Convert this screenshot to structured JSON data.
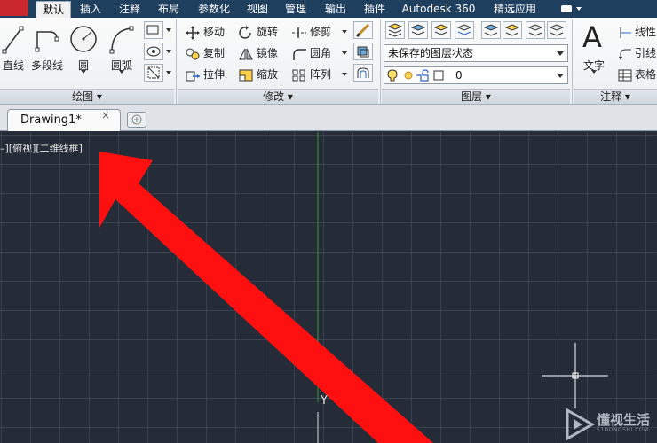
{
  "ribbon_tabs": [
    "默认",
    "插入",
    "注释",
    "布局",
    "参数化",
    "视图",
    "管理",
    "输出",
    "插件",
    "Autodesk 360",
    "精选应用"
  ],
  "active_tab_index": 0,
  "draw_panel": {
    "title": "绘图",
    "line_label": "直线",
    "polyline_label": "多段线",
    "circle_label": "圆",
    "arc_label": "圆弧"
  },
  "modify_panel": {
    "title": "修改",
    "move": "移动",
    "rotate": "旋转",
    "trim": "修剪",
    "copy": "复制",
    "mirror": "镜像",
    "fillet": "圆角",
    "stretch": "拉伸",
    "scale": "缩放",
    "array": "阵列"
  },
  "layers_panel": {
    "title": "图层",
    "layer_state": "未保存的图层状态",
    "current_layer": "0"
  },
  "annotation_panel": {
    "title": "注释",
    "text_label": "文字",
    "linear": "线性",
    "leader": "引线",
    "table": "表格"
  },
  "document": {
    "tab_title": "Drawing1*",
    "close_glyph": "×"
  },
  "viewport": {
    "view_label": "–][俯视][二维线框]",
    "ucs_y_label": "Y"
  },
  "watermark": {
    "text": "懂视生活",
    "subtext": "51DONGSHI.COM"
  },
  "colors": {
    "canvas_bg": "#252b37",
    "arrow_red": "#ff1010",
    "tab_bar": "#1f3f5f",
    "app_button": "#c8282e",
    "y_axis": "#3a9a3a"
  }
}
